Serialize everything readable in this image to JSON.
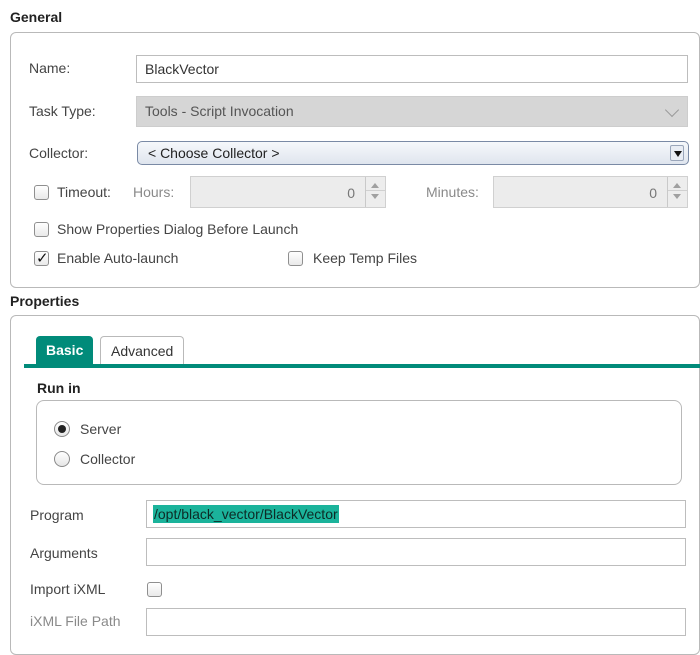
{
  "general": {
    "title": "General",
    "name_label": "Name:",
    "name_value": "BlackVector",
    "task_type_label": "Task Type:",
    "task_type_value": "Tools - Script Invocation",
    "collector_label": "Collector:",
    "collector_value": "< Choose Collector >",
    "timeout_label": "Timeout:",
    "timeout_checked": false,
    "hours_label": "Hours:",
    "hours_value": "0",
    "minutes_label": "Minutes:",
    "minutes_value": "0",
    "show_props_label": "Show Properties Dialog Before Launch",
    "show_props_checked": false,
    "auto_launch_label": "Enable Auto-launch",
    "auto_launch_checked": true,
    "keep_temp_label": "Keep Temp Files",
    "keep_temp_checked": false
  },
  "properties": {
    "title": "Properties",
    "tabs": [
      {
        "label": "Basic",
        "active": true
      },
      {
        "label": "Advanced",
        "active": false
      }
    ],
    "run_in": {
      "title": "Run in",
      "options": [
        {
          "label": "Server",
          "selected": true
        },
        {
          "label": "Collector",
          "selected": false
        }
      ]
    },
    "program_label": "Program",
    "program_value": "/opt/black_vector/BlackVector",
    "arguments_label": "Arguments",
    "arguments_value": "",
    "import_ixml_label": "Import iXML",
    "import_ixml_checked": false,
    "ixml_path_label": "iXML File Path",
    "ixml_path_value": ""
  },
  "colors": {
    "accent": "#018b7a",
    "selection": "#1bb39b"
  }
}
